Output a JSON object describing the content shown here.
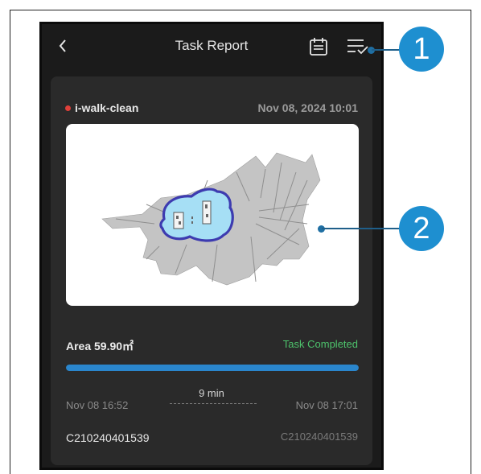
{
  "header": {
    "title": "Task Report",
    "back_icon": "chevron-left-icon",
    "calendar_icon": "calendar-icon",
    "filter_icon": "filter-list-check-icon"
  },
  "report": {
    "robot_name": "i-walk-clean",
    "robot_status_color": "#e0403a",
    "datetime": "Nov 08, 2024 10:01",
    "area": "Area 59.90㎡",
    "task_status": "Task Completed",
    "task_status_color": "#4dc26b",
    "progress": 1.0,
    "progress_color": "#2a86cd",
    "duration": "9 min",
    "start_time": "Nov 08 16:52",
    "end_time": "Nov 08 17:01",
    "serial_left": "C210240401539",
    "serial_right": "C210240401539"
  },
  "callouts": [
    {
      "label": "1",
      "color": "#1e8fd0"
    },
    {
      "label": "2",
      "color": "#1e8fd0"
    }
  ],
  "colors": {
    "app_background": "#1b1b1b",
    "card_background": "#2a2a2a",
    "map_cleaned_area": "#a6dff5",
    "map_boundary": "#3d3bb0"
  }
}
